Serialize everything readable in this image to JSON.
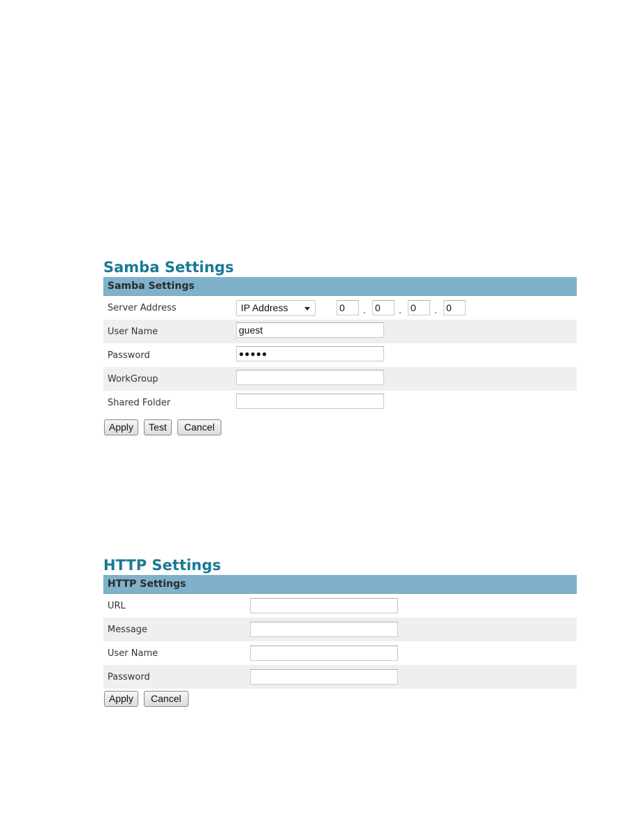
{
  "samba": {
    "title": "Samba Settings",
    "bar_title": "Samba Settings",
    "rows": {
      "server_address": {
        "label": "Server Address",
        "select_value": "IP Address",
        "ip": [
          "0",
          "0",
          "0",
          "0"
        ],
        "ip_separator": "."
      },
      "user_name": {
        "label": "User Name",
        "value": "guest"
      },
      "password": {
        "label": "Password",
        "value": "●●●●●"
      },
      "workgroup": {
        "label": "WorkGroup",
        "value": ""
      },
      "shared_folder": {
        "label": "Shared Folder",
        "value": ""
      }
    },
    "buttons": {
      "apply": "Apply",
      "test": "Test",
      "cancel": "Cancel"
    }
  },
  "http": {
    "title": "HTTP Settings",
    "bar_title": "HTTP Settings",
    "rows": {
      "url": {
        "label": "URL",
        "value": ""
      },
      "message": {
        "label": "Message",
        "value": ""
      },
      "user_name": {
        "label": "User Name",
        "value": ""
      },
      "password": {
        "label": "Password",
        "value": ""
      }
    },
    "buttons": {
      "apply": "Apply",
      "cancel": "Cancel"
    }
  },
  "colors": {
    "title": "#1a7a94",
    "bar": "#7fb1cb",
    "alt_row": "#efefef"
  }
}
